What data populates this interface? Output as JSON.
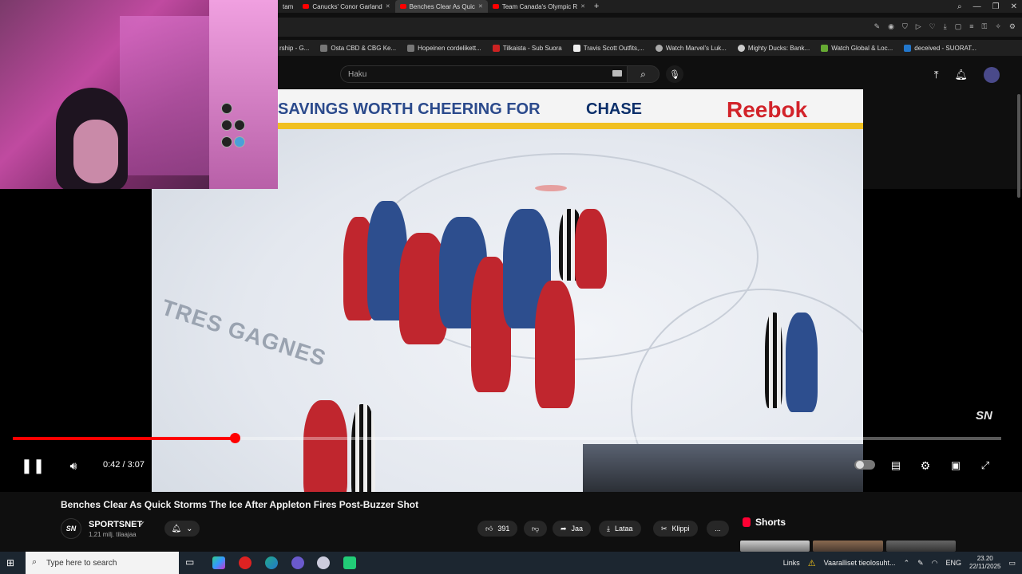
{
  "browser": {
    "tabs": [
      {
        "label": "tam"
      },
      {
        "label": "Canucks' Conor Garland"
      },
      {
        "label": "Benches Clear As Quic",
        "active": true
      },
      {
        "label": "Team Canada's Olympic R"
      }
    ],
    "new_tab": "+",
    "bookmarks": [
      "rship - G...",
      "Osta CBD & CBG Ke...",
      "Hopeinen cordelikett...",
      "Tilkaista - Sub Suora",
      "Travis Scott Outfits,...",
      "Watch Marvel's Luk...",
      "Mighty Ducks: Bank...",
      "Watch Global & Loc...",
      "deceived - SUORAT..."
    ]
  },
  "youtube": {
    "search_placeholder": "Haku"
  },
  "video": {
    "board_savings": "SAVINGS WORTH CHEERING FOR",
    "board_chase": "CHASE",
    "board_reebok": "Reebok",
    "ice_text": "TRES GAGNES",
    "watermark": "SN",
    "current_time": "0:42",
    "duration": "3:07",
    "time_display": "0:42 / 3:07",
    "progress_fraction": 0.2246
  },
  "meta": {
    "title": "Benches Clear As Quick Storms The Ice After Appleton Fires Post-Buzzer Shot",
    "channel": "SPORTSNET",
    "channel_avatar": "SN",
    "subscribers": "1,21 milj. tilaajaa",
    "likes": "391",
    "share": "Jaa",
    "download": "Lataa",
    "clip": "Klippi",
    "more": "...",
    "shorts": "Shorts"
  },
  "taskbar": {
    "search_placeholder": "Type here to search",
    "links": "Links",
    "warning": "Vaaralliset tieolosuht...",
    "lang": "ENG",
    "time": "23.20",
    "date": "22/11/2025"
  },
  "colors": {
    "progress": "#ff0000",
    "youtube_bg": "#0f0f0f",
    "taskbar": "#1c2630"
  }
}
